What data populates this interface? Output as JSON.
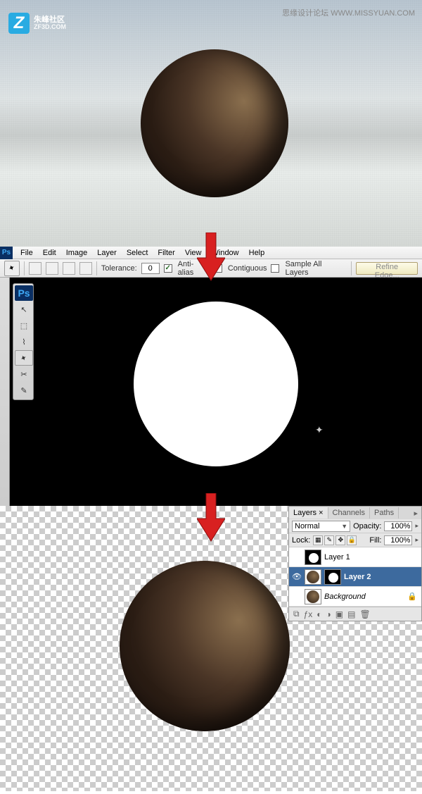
{
  "watermark": {
    "left_cn": "朱峰社区",
    "left_sub": "ZF3D.COM",
    "right": "思缘设计论坛 WWW.MISSYUAN.COM"
  },
  "menu": {
    "file": "File",
    "edit": "Edit",
    "image": "Image",
    "layer": "Layer",
    "select": "Select",
    "filter": "Filter",
    "view": "View",
    "window": "Window",
    "help": "Help"
  },
  "options": {
    "tolerance_label": "Tolerance:",
    "tolerance_value": "0",
    "anti_alias": "Anti-alias",
    "contiguous": "Contiguous",
    "sample_all": "Sample All Layers",
    "refine": "Refine Edge..."
  },
  "layers_panel": {
    "tabs": {
      "layers": "Layers",
      "channels": "Channels",
      "paths": "Paths"
    },
    "blend_mode": "Normal",
    "opacity_label": "Opacity:",
    "opacity_value": "100%",
    "lock_label": "Lock:",
    "fill_label": "Fill:",
    "fill_value": "100%",
    "items": [
      {
        "name": "Layer 1"
      },
      {
        "name": "Layer 2"
      },
      {
        "name": "Background"
      }
    ]
  },
  "toolbox": {
    "ps": "Ps"
  }
}
